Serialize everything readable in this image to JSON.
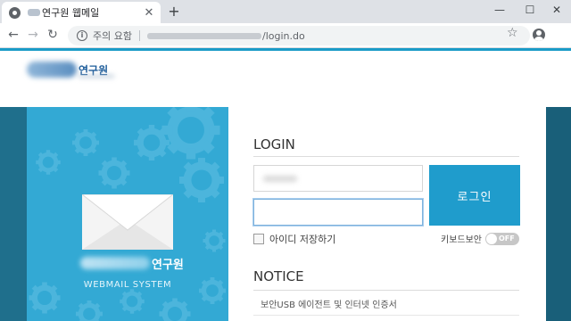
{
  "browser": {
    "tab_title": "연구원 웹메일",
    "tab_close": "✕",
    "new_tab": "+",
    "security_label": "주의 요함",
    "url_path": "/login.do",
    "window_controls": {
      "minimize": "—",
      "maximize": "☐",
      "close": "✕"
    },
    "icons": [
      "globe-icon",
      "back-icon",
      "forward-icon",
      "reload-icon",
      "info-icon",
      "star-icon",
      "profile-icon"
    ]
  },
  "header": {
    "org_name": "연구원"
  },
  "brand": {
    "org_name": "연구원",
    "subtitle": "WEBMAIL SYSTEM"
  },
  "login": {
    "title": "LOGIN",
    "button": "로그인",
    "save_id": "아이디 저장하기",
    "keyboard_security": "키보드보안",
    "toggle_state": "OFF"
  },
  "notice": {
    "title": "NOTICE",
    "items": [
      "보안USB 에이전트 및 인터넷 인증서"
    ]
  },
  "colors": {
    "accent": "#1a9bc7",
    "brand_panel": "#33a9d4",
    "login_button": "#1f9ccc",
    "background_band": "#1f6f8c"
  }
}
